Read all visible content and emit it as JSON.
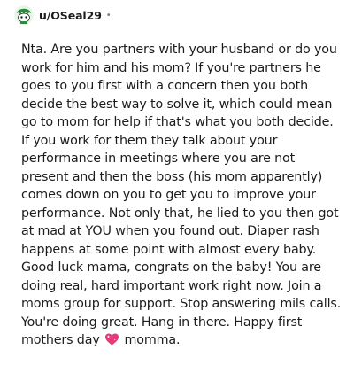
{
  "comment": {
    "author": "u/OSeal29",
    "separator": "•",
    "avatar_icon": "snoo-avatar-green-hair",
    "body_text": "Nta. Are you partners with your husband or do you work for him and his mom? If you're partners he goes to you first with a concern then you both decide the best way to solve it, which could mean go to mom for help if that's what you both decide. If you work for them they talk about your performance in meetings where you are not present and then the boss (his mom apparently) comes down on you to get you to improve your performance. Not only that, he lied to you then got at mad at YOU when you found out. Diaper rash happens at some point with almost every baby. Good luck mama, congrats on the baby! You are doing real, hard important work right now. Join a moms group for support. Stop answering mils calls. You're doing great. Hang in there. Happy first mothers day",
    "emoji_icon": "sparkling-heart-icon",
    "body_end": "momma."
  },
  "colors": {
    "text": "#1c1c1c",
    "muted": "#7c7c7c",
    "emoji_pink": "#e8397a"
  }
}
